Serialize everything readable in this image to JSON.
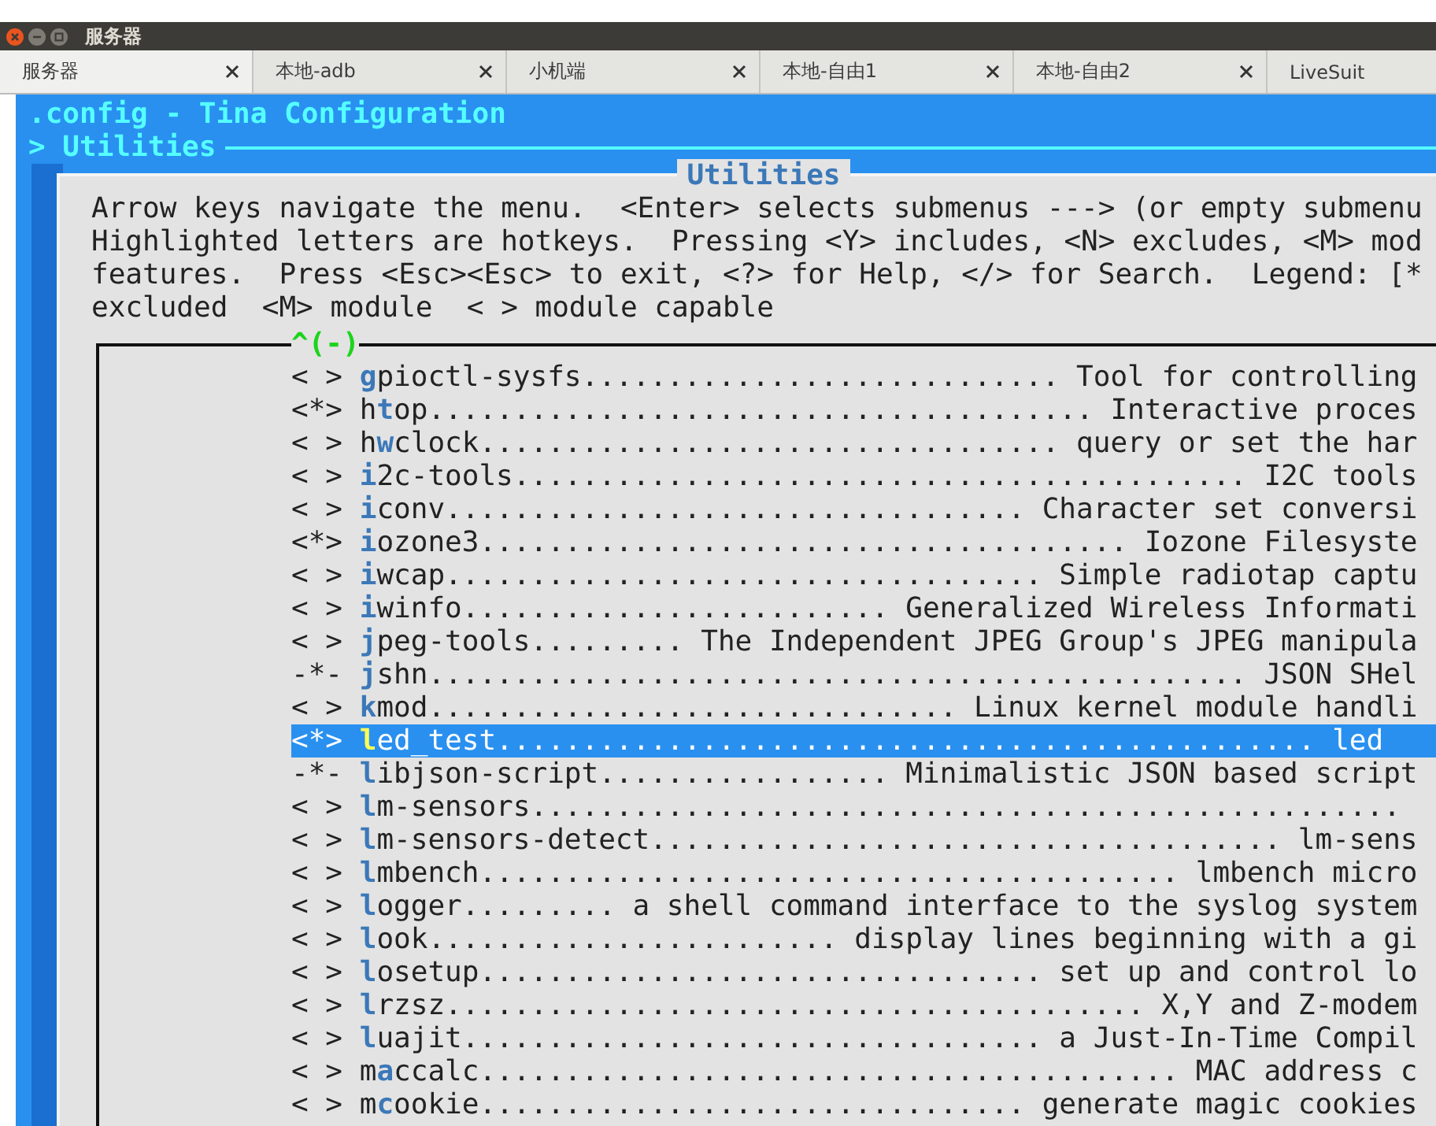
{
  "window": {
    "title": "服务器"
  },
  "tabs": [
    {
      "label": "服务器",
      "selected": true
    },
    {
      "label": "本地-adb",
      "selected": false
    },
    {
      "label": "小机端",
      "selected": false
    },
    {
      "label": "本地-自由1",
      "selected": false
    },
    {
      "label": "本地-自由2",
      "selected": false
    },
    {
      "label": "LiveSuit",
      "selected": false
    }
  ],
  "terminal": {
    "title": ".config - Tina Configuration",
    "breadcrumb": "> Utilities",
    "dialog": {
      "title": "Utilities",
      "help": [
        "Arrow keys navigate the menu.  <Enter> selects submenus ---> (or empty submenu",
        "Highlighted letters are hotkeys.  Pressing <Y> includes, <N> excludes, <M> mod",
        "features.  Press <Esc><Esc> to exit, <?> for Help, </> for Search.  Legend: [*",
        "excluded  <M> module  < > module capable"
      ],
      "scroll_indicator": "^(-)",
      "items": [
        {
          "state": "< >",
          "hotkey": "g",
          "after": "pioctl-sysfs............................ Tool for controlling",
          "selected": false
        },
        {
          "state": "<*>",
          "before": "h",
          "hotkey": "t",
          "after": "op....................................... Interactive proces",
          "selected": false
        },
        {
          "state": "< >",
          "before": "h",
          "hotkey": "w",
          "after": "clock.................................. query or set the har",
          "selected": false
        },
        {
          "state": "< >",
          "hotkey": "i",
          "after": "2c-tools........................................... I2C tools",
          "selected": false
        },
        {
          "state": "< >",
          "hotkey": "i",
          "after": "conv.................................. Character set conversi",
          "selected": false
        },
        {
          "state": "<*>",
          "hotkey": "i",
          "after": "ozone3...................................... Iozone Filesyste",
          "selected": false
        },
        {
          "state": "< >",
          "hotkey": "i",
          "after": "wcap................................... Simple radiotap captu",
          "selected": false
        },
        {
          "state": "< >",
          "hotkey": "i",
          "after": "winfo......................... Generalized Wireless Informati",
          "selected": false
        },
        {
          "state": "< >",
          "hotkey": "j",
          "after": "peg-tools......... The Independent JPEG Group's JPEG manipula",
          "selected": false
        },
        {
          "state": "-*-",
          "hotkey": "j",
          "after": "shn................................................ JSON SHel",
          "selected": false
        },
        {
          "state": "< >",
          "hotkey": "k",
          "after": "mod............................... Linux kernel module handli",
          "selected": false
        },
        {
          "state": "<*>",
          "hotkey": "l",
          "after": "ed_test................................................ led",
          "selected": true
        },
        {
          "state": "-*-",
          "hotkey": "l",
          "after": "ibjson-script................. Minimalistic JSON based script",
          "selected": false
        },
        {
          "state": "< >",
          "hotkey": "l",
          "after": "m-sensors...................................................",
          "selected": false
        },
        {
          "state": "< >",
          "hotkey": "l",
          "after": "m-sensors-detect..................................... lm-sens",
          "selected": false
        },
        {
          "state": "< >",
          "hotkey": "l",
          "after": "mbench......................................... lmbench micro",
          "selected": false
        },
        {
          "state": "< >",
          "hotkey": "l",
          "after": "ogger......... a shell command interface to the syslog system",
          "selected": false
        },
        {
          "state": "< >",
          "hotkey": "l",
          "after": "ook........................ display lines beginning with a gi",
          "selected": false
        },
        {
          "state": "< >",
          "hotkey": "l",
          "after": "osetup................................. set up and control lo",
          "selected": false
        },
        {
          "state": "< >",
          "hotkey": "l",
          "after": "rzsz......................................... X,Y and Z-modem",
          "selected": false
        },
        {
          "state": "< >",
          "hotkey": "l",
          "after": "uajit.................................. a Just-In-Time Compil",
          "selected": false
        },
        {
          "state": "< >",
          "before": "m",
          "hotkey": "a",
          "after": "ccalc......................................... MAC address c",
          "selected": false
        },
        {
          "state": "< >",
          "before": "m",
          "hotkey": "c",
          "after": "ookie................................ generate magic cookies",
          "selected": false
        }
      ]
    }
  }
}
